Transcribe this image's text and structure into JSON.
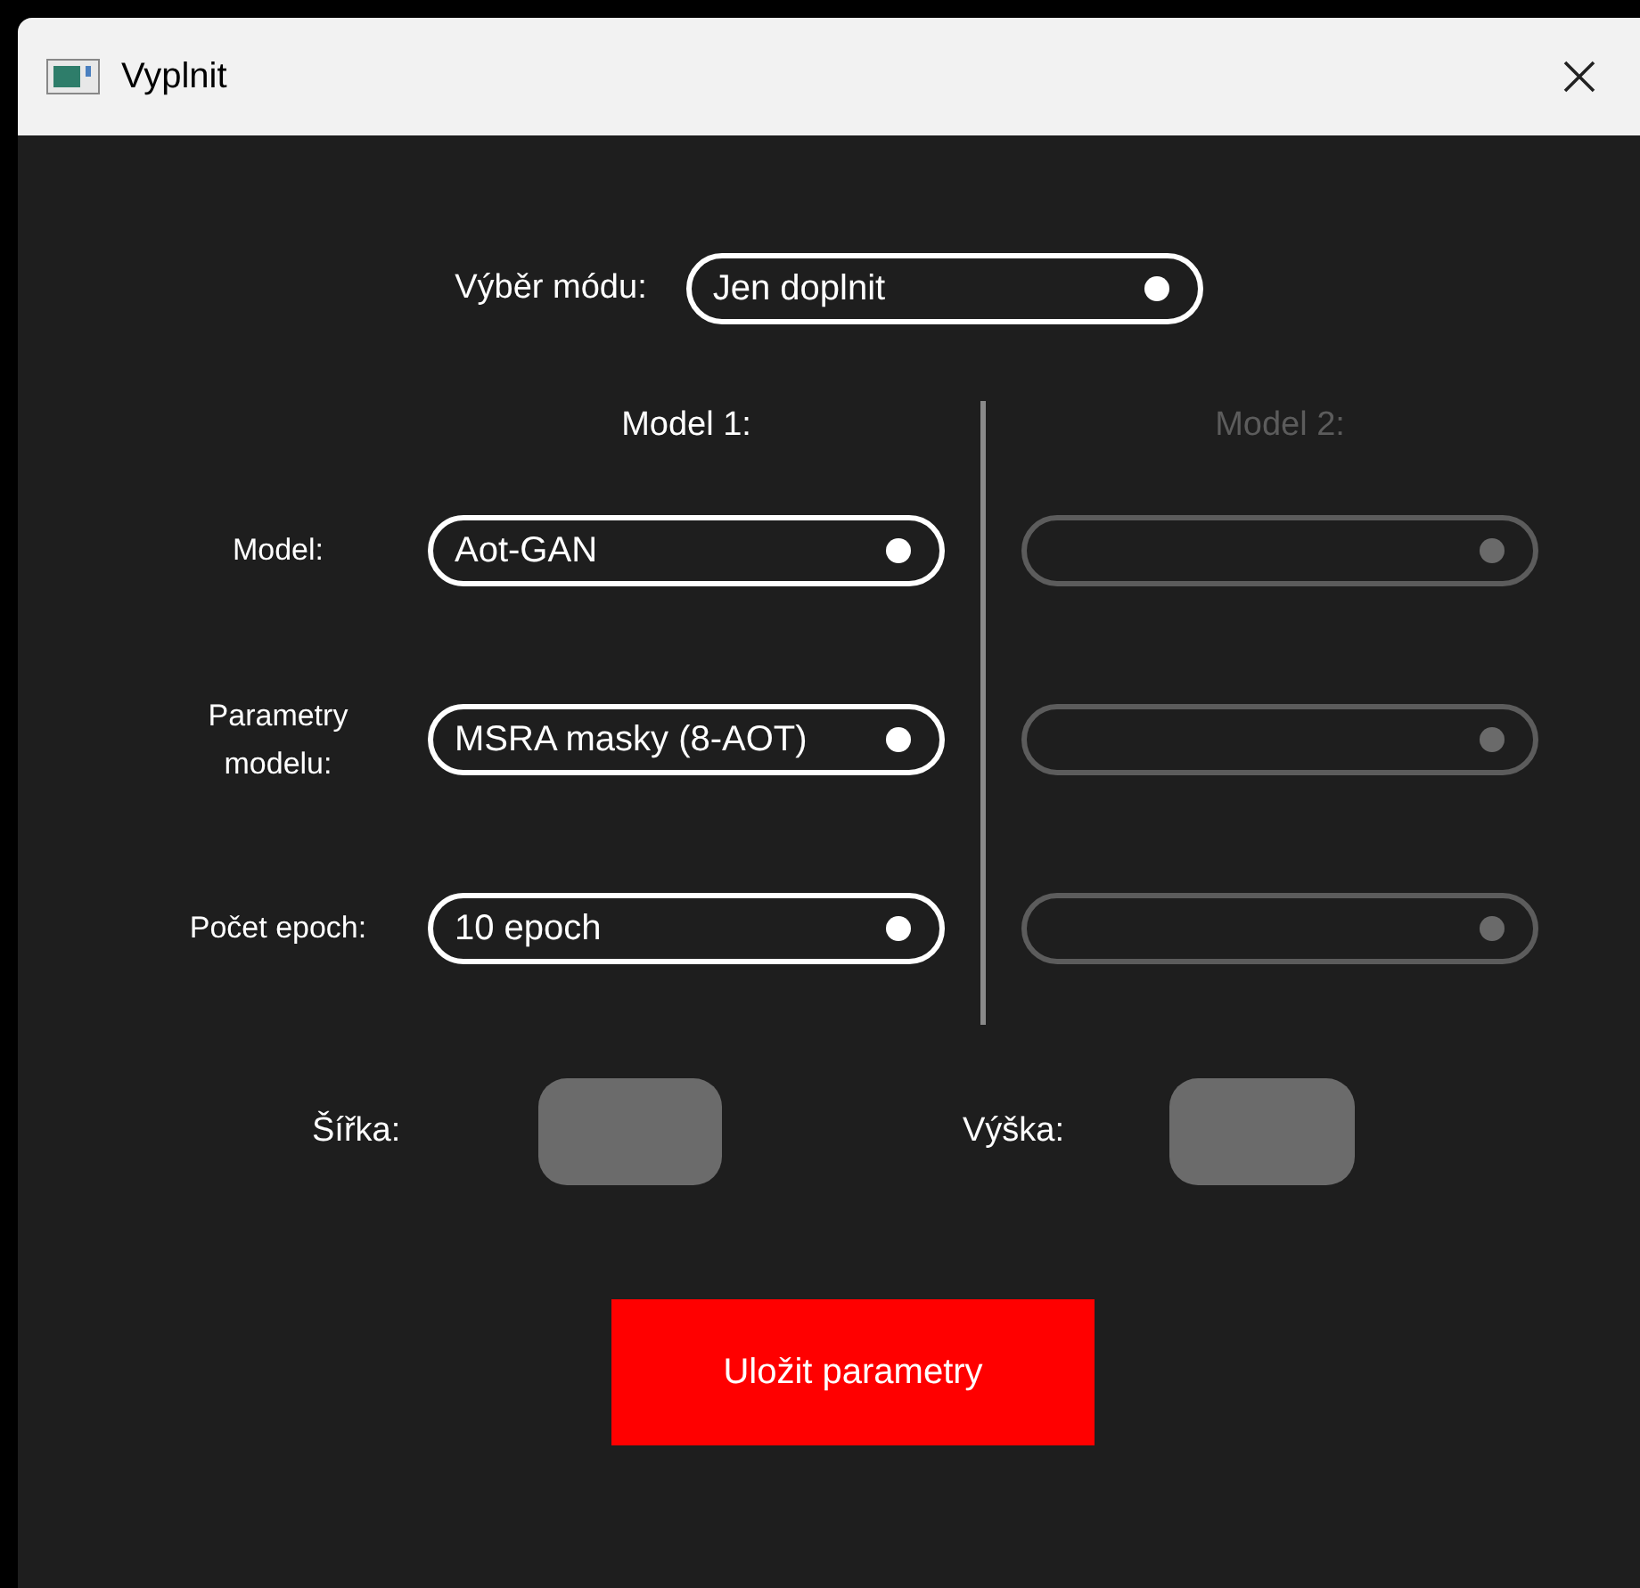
{
  "window": {
    "title": "Vyplnit"
  },
  "mode": {
    "label": "Výběr módu:",
    "value": "Jen doplnit"
  },
  "column_headers": [
    {
      "text": "Model 1:",
      "disabled": false
    },
    {
      "text": "Model 2:",
      "disabled": true
    }
  ],
  "rows": [
    {
      "label": "Model:",
      "model_1": {
        "value": "Aot-GAN",
        "disabled": false
      },
      "model_2": {
        "disabled": true
      }
    },
    {
      "label": "Parametry modelu:",
      "model_1": {
        "value": "MSRA masky (8-AOT)",
        "disabled": false
      },
      "model_2": {
        "disabled": true
      }
    },
    {
      "label": "Počet epoch:",
      "model_1": {
        "value": "10 epoch",
        "disabled": false
      },
      "model_2": {
        "disabled": true
      }
    }
  ],
  "size": [
    {
      "label": "Šířka:"
    },
    {
      "label": "Výška:"
    }
  ],
  "button": "Uložit parametry"
}
